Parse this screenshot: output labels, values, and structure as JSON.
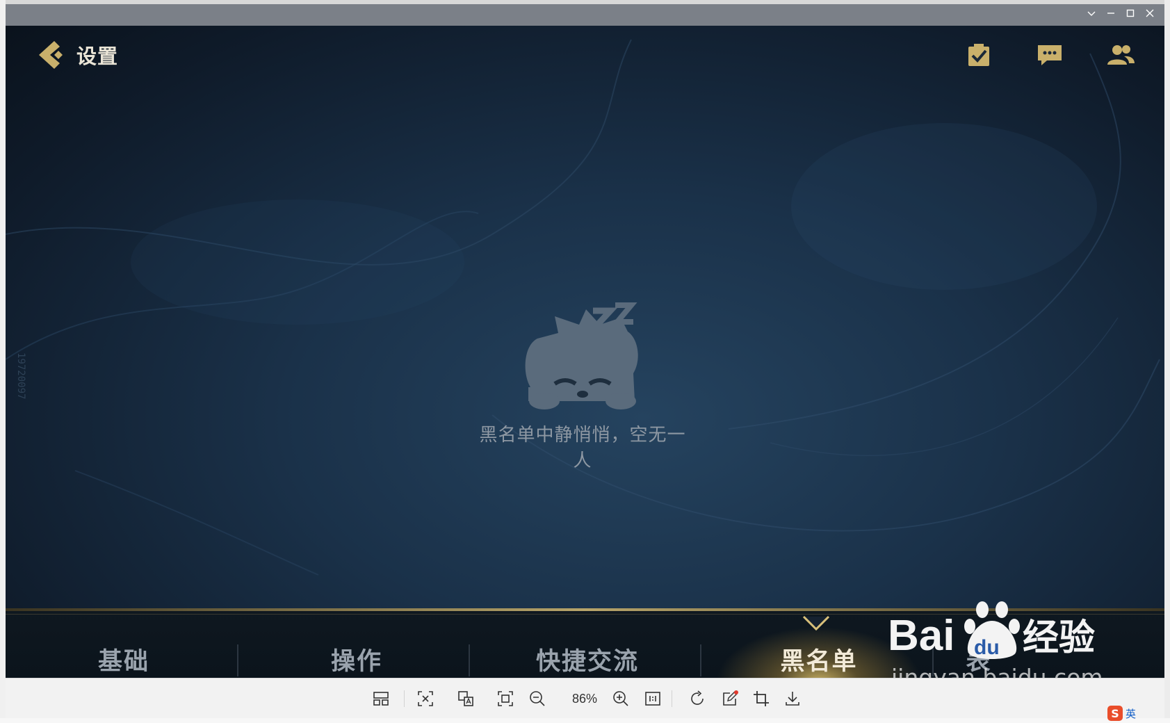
{
  "window": {
    "controls": [
      "chevron-down",
      "minimize",
      "maximize",
      "close"
    ]
  },
  "header": {
    "back_title": "设置"
  },
  "top_icons": [
    "checklist-icon",
    "chat-icon",
    "friends-icon"
  ],
  "empty_state": {
    "message": "黑名单中静悄悄，空无一人"
  },
  "tabs": [
    {
      "label": "基础",
      "active": false
    },
    {
      "label": "操作",
      "active": false
    },
    {
      "label": "快捷交流",
      "active": false
    },
    {
      "label": "黑名单",
      "active": true
    },
    {
      "label": "表",
      "active": false
    }
  ],
  "side_id": "19720097",
  "watermark": {
    "logo": "Baidu经验",
    "url": "jingyan.baidu.com"
  },
  "toolbar": {
    "zoom": "86%"
  },
  "ime": {
    "logo": "S",
    "lang": "英"
  },
  "colors": {
    "gold": "#c9b06b",
    "active_tab": "#f2ead8",
    "inactive_tab": "#9aa3ad",
    "background": "#1a3149"
  }
}
